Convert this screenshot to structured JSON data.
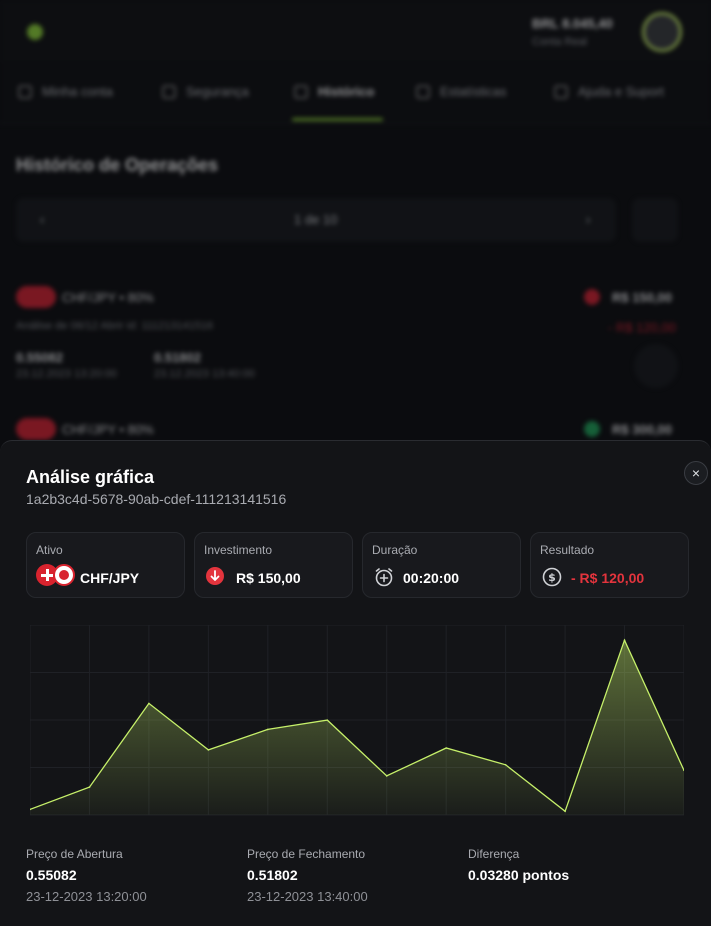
{
  "background": {
    "balance": "BRL 8.045,40",
    "balance_sub": "Conta Real",
    "tabs": [
      "Minha conta",
      "Segurança",
      "Histórico",
      "Estatísticas",
      "Ajuda e Suport"
    ],
    "section_title": "Histórico de Operações",
    "pager_text": "1 de 10",
    "pager_prev": "‹",
    "pager_next": "›",
    "row1_asset": "CHF/JPY • 80%",
    "row1_amount": "R$ 150,00",
    "row1_result": "- R$ 120,00",
    "row1_meta": "Análise de 06/12 Abrir id: 111213141516",
    "row1_open": "0.55082",
    "row1_open_date": "23.12.2023 13:20:00",
    "row1_close": "0.51802",
    "row1_close_date": "23.12.2023 13:40:00",
    "row2_asset": "CHF/JPY • 80%",
    "row2_amount": "R$ 300,00"
  },
  "modal": {
    "title": "Análise gráfica",
    "id": "1a2b3c4d-5678-90ab-cdef-111213141516",
    "close_label": "×",
    "cards": {
      "asset_label": "Ativo",
      "asset_value": "CHF/JPY",
      "investment_label": "Investimento",
      "investment_value": "R$ 150,00",
      "duration_label": "Duração",
      "duration_value": "00:20:00",
      "result_label": "Resultado",
      "result_value": "- R$ 120,00"
    },
    "stats": {
      "open_label": "Preço de Abertura",
      "open_value": "0.55082",
      "open_date": "23-12-2023 13:20:00",
      "close_label": "Preço de Fechamento",
      "close_value": "0.51802",
      "close_date": "23-12-2023 13:40:00",
      "diff_label": "Diferença",
      "diff_value": "0.03280 pontos"
    }
  },
  "colors": {
    "accent": "#c6f06a",
    "negative": "#e3343d",
    "positive": "#1fa35a"
  },
  "chart_data": {
    "type": "area",
    "values": [
      0.3,
      1.5,
      6.0,
      3.5,
      4.6,
      5.1,
      2.1,
      3.6,
      2.7,
      0.2,
      9.4,
      2.4
    ],
    "ylim": [
      0,
      10
    ],
    "grid": true
  }
}
